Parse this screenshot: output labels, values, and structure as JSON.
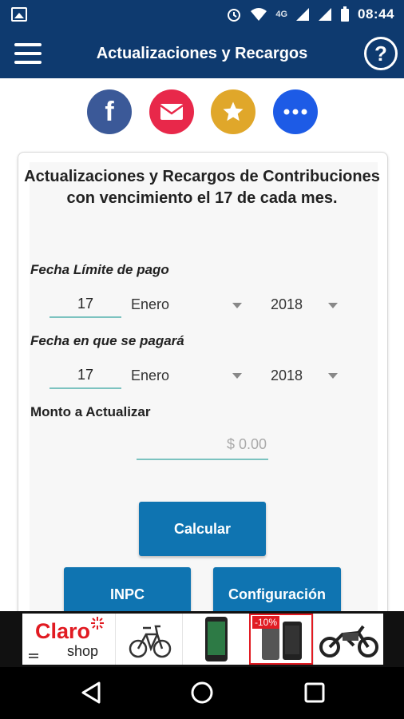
{
  "status_bar": {
    "time": "08:44",
    "network": "4G"
  },
  "app_bar": {
    "title": "Actualizaciones y Recargos",
    "help_label": "?"
  },
  "social": {
    "facebook_label": "f",
    "more_label": "•••"
  },
  "card": {
    "heading": "Actualizaciones y Recargos de Contribuciones con vencimiento el 17 de cada mes.",
    "due_date": {
      "label": "Fecha Límite de pago",
      "day": "17",
      "month": "Enero",
      "year": "2018"
    },
    "pay_date": {
      "label": "Fecha en que se pagará",
      "day": "17",
      "month": "Enero",
      "year": "2018"
    },
    "amount": {
      "label": "Monto a Actualizar",
      "placeholder": "$ 0.00"
    },
    "buttons": {
      "calculate": "Calcular",
      "inpc": "INPC",
      "config": "Configuración"
    }
  },
  "ad": {
    "brand": "Claro",
    "brand_sub": "shop",
    "discount": "-10%"
  },
  "colors": {
    "primary": "#0e3a6f",
    "button": "#0f74b1",
    "accent_line": "#7cc3c0"
  }
}
